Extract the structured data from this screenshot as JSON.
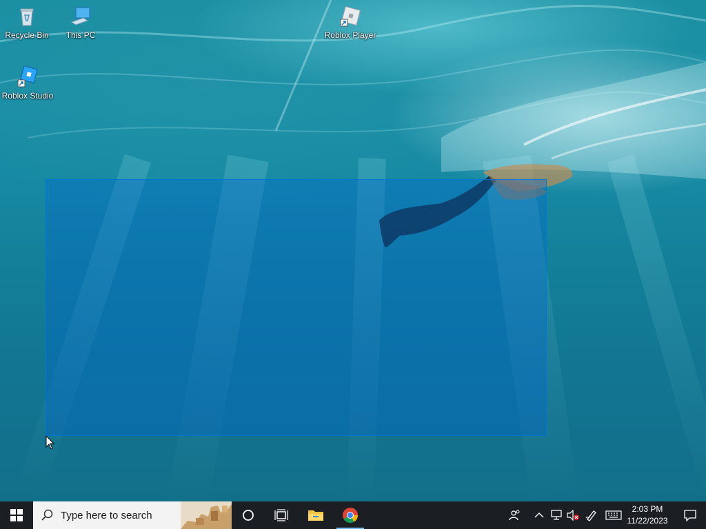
{
  "desktop": {
    "icons": [
      {
        "label": "Recycle Bin",
        "icon": "recycle-bin-icon"
      },
      {
        "label": "This PC",
        "icon": "this-pc-icon"
      },
      {
        "label": "Roblox Player",
        "icon": "roblox-player-icon"
      },
      {
        "label": "Roblox Studio",
        "icon": "roblox-studio-icon"
      }
    ],
    "selection_color": "#0078d7"
  },
  "taskbar": {
    "search_placeholder": "Type here to search",
    "pinned": [
      {
        "name": "cortana",
        "icon": "cortana-circle-icon"
      },
      {
        "name": "task-view",
        "icon": "task-view-icon"
      },
      {
        "name": "file-explorer",
        "icon": "folder-icon"
      },
      {
        "name": "chrome",
        "icon": "chrome-icon"
      }
    ],
    "tray": {
      "time": "2:03 PM",
      "date": "11/22/2023"
    },
    "accent": "#76b9ed",
    "background": "#1b1f23"
  }
}
